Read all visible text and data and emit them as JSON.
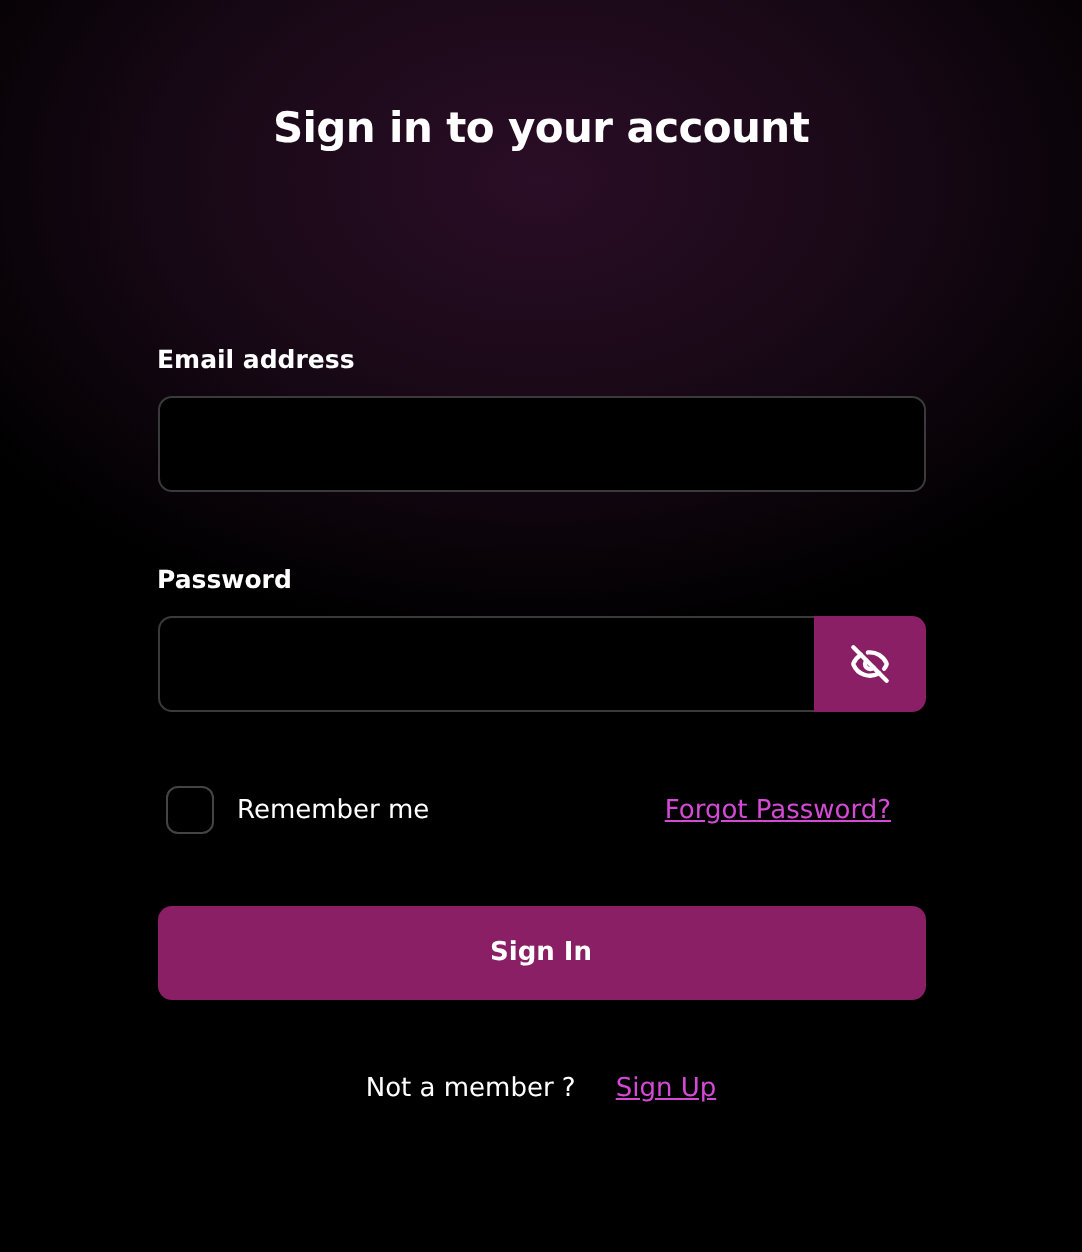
{
  "title": "Sign in to your account",
  "email": {
    "label": "Email address"
  },
  "password": {
    "label": "Password"
  },
  "remember": {
    "label": "Remember me",
    "checked": false
  },
  "forgot_link": "Forgot Password?",
  "submit": "Sign In",
  "footer": {
    "text": "Not a member ?",
    "link": "Sign Up"
  }
}
